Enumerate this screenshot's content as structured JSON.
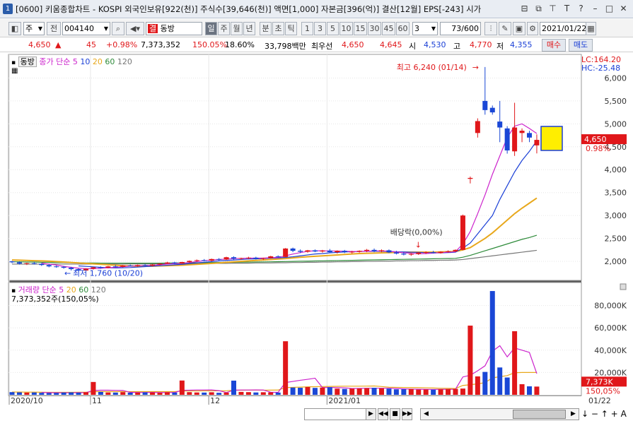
{
  "title": {
    "window_number": "1",
    "text": "[0600] 키움종합차트 - KOSPI 외국인보유[922(천)] 주식수[39,646(천)] 액면[1,000] 자본금[396(억)] 결산[12월] EPS[-243] 시가"
  },
  "toolbar": {
    "market": "주",
    "prev": "전",
    "code": "004140",
    "name_tag": "결",
    "name": "동방",
    "periods": [
      "일",
      "주",
      "월",
      "년",
      "분",
      "초",
      "틱"
    ],
    "active_period": "일",
    "intervals": [
      "1",
      "3",
      "5",
      "10",
      "15",
      "30",
      "45",
      "60"
    ],
    "custom": "3",
    "count": "73/600",
    "date": "2021/01/22"
  },
  "quote": {
    "price": "4,650",
    "arrow": "▲",
    "change": "45",
    "change_pct": "+0.98%",
    "volume": "7,373,352",
    "vol_pct": "150.05%",
    "turnover": "18.60%",
    "amount": "33,798백만",
    "best_label": "최우선",
    "ask": "4,650",
    "bid": "4,645",
    "open_label": "시",
    "open": "4,530",
    "high_label": "고",
    "high": "4,770",
    "low_label": "저",
    "low": "4,355",
    "buy": "매수",
    "sell": "매도"
  },
  "price_panel": {
    "name": "동방",
    "ma_label": "종가 단순",
    "ma_periods": [
      "5",
      "10",
      "20",
      "60",
      "120"
    ],
    "lc": "LC:164.20",
    "hc": "HC:-25.48",
    "y_ticks": [
      "6,000",
      "5,500",
      "5,000",
      "4,500",
      "4,000",
      "3,500",
      "3,000",
      "2,500",
      "2,000"
    ],
    "current_price": "4,650",
    "current_pct": "0.98%",
    "high_annotation": "최고 6,240 (01/14)",
    "low_annotation": "최저 1,760 (10/20)",
    "dividend_annotation": "배당락(0,00%)"
  },
  "volume_panel": {
    "label": "거래량",
    "ma_label": "단순",
    "ma_periods": [
      "5",
      "20",
      "60",
      "120"
    ],
    "value_text": "7,373,352주(150,05%)",
    "y_ticks": [
      "80,000K",
      "60,000K",
      "40,000K",
      "20,000K"
    ],
    "current_vol": "7,373K",
    "current_pct": "150,05%"
  },
  "x_axis": {
    "labels": [
      "2020/10",
      "11",
      "12",
      "2021/01"
    ],
    "right_label": "01/22"
  },
  "colors": {
    "up": "#e0171a",
    "down": "#1a47d6",
    "ma5": "#cc22cc",
    "ma10": "#1a3fd6",
    "ma20": "#e8a81c",
    "ma60": "#2e8b3a",
    "ma120": "#777777"
  },
  "chart_data": {
    "type": "candlestick",
    "candles": [
      [
        2000,
        2010,
        1960,
        1980
      ],
      [
        1980,
        2000,
        1930,
        1950
      ],
      [
        1950,
        1970,
        1920,
        1960
      ],
      [
        1960,
        1990,
        1930,
        1945
      ],
      [
        1945,
        1960,
        1900,
        1920
      ],
      [
        1920,
        1940,
        1870,
        1890
      ],
      [
        1890,
        1910,
        1860,
        1880
      ],
      [
        1880,
        1900,
        1840,
        1860
      ],
      [
        1860,
        1880,
        1800,
        1830
      ],
      [
        1830,
        1850,
        1760,
        1800
      ],
      [
        1800,
        1850,
        1790,
        1840
      ],
      [
        1840,
        1880,
        1820,
        1870
      ],
      [
        1870,
        1890,
        1840,
        1860
      ],
      [
        1860,
        1900,
        1850,
        1890
      ],
      [
        1890,
        1920,
        1870,
        1880
      ],
      [
        1880,
        1920,
        1870,
        1910
      ],
      [
        1910,
        1930,
        1890,
        1900
      ],
      [
        1900,
        1930,
        1880,
        1920
      ],
      [
        1920,
        1940,
        1890,
        1905
      ],
      [
        1905,
        1940,
        1890,
        1930
      ],
      [
        1930,
        1960,
        1920,
        1950
      ],
      [
        1950,
        1990,
        1940,
        1975
      ],
      [
        1975,
        1990,
        1940,
        1955
      ],
      [
        1955,
        1990,
        1950,
        1985
      ],
      [
        1985,
        2020,
        1970,
        2010
      ],
      [
        2010,
        2040,
        1990,
        2025
      ],
      [
        2025,
        2050,
        2000,
        2015
      ],
      [
        2015,
        2060,
        2000,
        2050
      ],
      [
        2050,
        2070,
        2020,
        2040
      ],
      [
        2040,
        2100,
        2030,
        2090
      ],
      [
        2090,
        2110,
        2040,
        2060
      ],
      [
        2060,
        2080,
        2030,
        2070
      ],
      [
        2070,
        2100,
        2050,
        2080
      ],
      [
        2080,
        2100,
        2040,
        2055
      ],
      [
        2055,
        2080,
        2030,
        2070
      ],
      [
        2070,
        2120,
        2060,
        2110
      ],
      [
        2110,
        2130,
        2080,
        2095
      ],
      [
        2095,
        2290,
        2090,
        2280
      ],
      [
        2280,
        2300,
        2200,
        2230
      ],
      [
        2230,
        2260,
        2180,
        2210
      ],
      [
        2210,
        2250,
        2190,
        2240
      ],
      [
        2240,
        2260,
        2200,
        2215
      ],
      [
        2215,
        2250,
        2190,
        2235
      ],
      [
        2235,
        2270,
        2190,
        2200
      ],
      [
        2200,
        2240,
        2170,
        2230
      ],
      [
        2230,
        2250,
        2180,
        2200
      ],
      [
        2200,
        2230,
        2170,
        2210
      ],
      [
        2210,
        2240,
        2190,
        2230
      ],
      [
        2230,
        2270,
        2200,
        2250
      ],
      [
        2250,
        2280,
        2200,
        2220
      ],
      [
        2220,
        2260,
        2200,
        2240
      ],
      [
        2240,
        2260,
        2180,
        2195
      ],
      [
        2195,
        2230,
        2150,
        2170
      ],
      [
        2170,
        2200,
        2130,
        2150
      ],
      [
        2150,
        2180,
        2120,
        2160
      ],
      [
        2160,
        2200,
        2140,
        2190
      ],
      [
        2190,
        2220,
        2160,
        2200
      ],
      [
        2200,
        2230,
        2170,
        2180
      ],
      [
        2180,
        2220,
        2170,
        2210
      ],
      [
        2210,
        2240,
        2190,
        2220
      ],
      [
        2220,
        2260,
        2200,
        2250
      ],
      [
        2250,
        3020,
        2240,
        3000
      ],
      [
        3800,
        3850,
        3700,
        3820
      ],
      [
        4800,
        5120,
        4700,
        5060
      ],
      [
        5500,
        6240,
        5200,
        5300
      ],
      [
        5350,
        5400,
        5200,
        5250
      ],
      [
        5050,
        5500,
        4600,
        4920
      ],
      [
        4900,
        4950,
        4350,
        4420
      ],
      [
        4400,
        5460,
        4300,
        4920
      ],
      [
        4800,
        4900,
        4600,
        4850
      ],
      [
        4800,
        4850,
        4600,
        4700
      ],
      [
        4530,
        4770,
        4355,
        4650
      ]
    ],
    "volume_k": [
      2400,
      2200,
      2000,
      2100,
      1800,
      1600,
      1700,
      2000,
      2200,
      1900,
      2300,
      11500,
      2600,
      2100,
      2000,
      2400,
      1900,
      2000,
      2200,
      2100,
      1800,
      2300,
      2000,
      12800,
      2400,
      2100,
      2000,
      2300,
      1800,
      2000,
      12700,
      2600,
      2400,
      2100,
      2300,
      2200,
      2000,
      48000,
      6500,
      6300,
      7000,
      6200,
      6500,
      6800,
      5500,
      5300,
      5600,
      5700,
      6000,
      6300,
      5800,
      5500,
      4900,
      5000,
      5200,
      4700,
      4800,
      4600,
      5000,
      5200,
      5300,
      5600,
      62000,
      16500,
      20500,
      93000,
      24500,
      15500,
      57000,
      9500,
      7600,
      7373
    ],
    "ma5": [
      null,
      null,
      null,
      null,
      1960,
      1940,
      1920,
      1890,
      1870,
      1850,
      1840,
      1840,
      1850,
      1860,
      1870,
      1885,
      1895,
      1905,
      1910,
      1915,
      1925,
      1940,
      1950,
      1960,
      1975,
      1995,
      2015,
      2030,
      2040,
      2050,
      2060,
      2065,
      2070,
      2070,
      2070,
      2080,
      2085,
      2120,
      2160,
      2190,
      2220,
      2230,
      2230,
      2225,
      2225,
      2220,
      2215,
      2215,
      2220,
      2225,
      2230,
      2220,
      2205,
      2190,
      2175,
      2165,
      2170,
      2180,
      2190,
      2200,
      2210,
      2380,
      2650,
      3040,
      3450,
      3900,
      4300,
      4700,
      4950,
      5000,
      4900,
      4790
    ],
    "ma10": [
      null,
      null,
      null,
      null,
      null,
      null,
      null,
      null,
      null,
      1900,
      1890,
      1880,
      1870,
      1860,
      1855,
      1860,
      1865,
      1875,
      1885,
      1895,
      1905,
      1915,
      1925,
      1935,
      1950,
      1965,
      1980,
      1995,
      2010,
      2020,
      2030,
      2040,
      2050,
      2055,
      2060,
      2070,
      2075,
      2085,
      2100,
      2120,
      2140,
      2160,
      2170,
      2185,
      2195,
      2205,
      2210,
      2215,
      2220,
      2220,
      2220,
      2215,
      2210,
      2205,
      2200,
      2195,
      2190,
      2185,
      2185,
      2190,
      2200,
      2290,
      2400,
      2600,
      2800,
      3000,
      3350,
      3650,
      3950,
      4200,
      4400,
      4630
    ],
    "ma20": [
      2030,
      2025,
      2020,
      2015,
      2010,
      2005,
      1995,
      1985,
      1975,
      1965,
      1955,
      1945,
      1935,
      1925,
      1915,
      1905,
      1900,
      1895,
      1895,
      1895,
      1900,
      1905,
      1910,
      1915,
      1925,
      1935,
      1945,
      1955,
      1965,
      1980,
      1990,
      2000,
      2010,
      2020,
      2030,
      2040,
      2050,
      2060,
      2075,
      2090,
      2100,
      2110,
      2120,
      2130,
      2140,
      2150,
      2160,
      2170,
      2175,
      2180,
      2185,
      2190,
      2195,
      2200,
      2200,
      2200,
      2200,
      2200,
      2205,
      2210,
      2215,
      2250,
      2300,
      2400,
      2500,
      2620,
      2760,
      2900,
      3040,
      3160,
      3270,
      3380
    ],
    "ma60": [
      1990,
      1990,
      1985,
      1985,
      1980,
      1980,
      1975,
      1975,
      1970,
      1970,
      1965,
      1965,
      1960,
      1960,
      1960,
      1960,
      1960,
      1960,
      1960,
      1960,
      1960,
      1962,
      1964,
      1966,
      1968,
      1970,
      1972,
      1974,
      1976,
      1978,
      1980,
      1982,
      1984,
      1986,
      1988,
      1990,
      1993,
      1996,
      1999,
      2002,
      2005,
      2008,
      2011,
      2014,
      2017,
      2020,
      2023,
      2026,
      2029,
      2032,
      2035,
      2038,
      2041,
      2044,
      2047,
      2050,
      2053,
      2056,
      2059,
      2062,
      2065,
      2090,
      2130,
      2180,
      2230,
      2280,
      2330,
      2380,
      2430,
      2480,
      2520,
      2570
    ],
    "ma120": [
      1940,
      1940,
      1940,
      1940,
      1940,
      1940,
      1940,
      1940,
      1940,
      1940,
      1940,
      1940,
      1940,
      1940,
      1940,
      1940,
      1945,
      1945,
      1945,
      1945,
      1945,
      1950,
      1950,
      1950,
      1950,
      1950,
      1955,
      1955,
      1955,
      1955,
      1960,
      1960,
      1960,
      1965,
      1965,
      1965,
      1970,
      1970,
      1975,
      1975,
      1980,
      1980,
      1985,
      1985,
      1990,
      1990,
      1995,
      1995,
      2000,
      2000,
      2005,
      2005,
      2010,
      2010,
      2015,
      2015,
      2020,
      2020,
      2025,
      2025,
      2030,
      2040,
      2060,
      2080,
      2100,
      2120,
      2140,
      2160,
      2180,
      2200,
      2220,
      2240
    ],
    "vol_ma5": [
      null,
      null,
      null,
      null,
      2100,
      1940,
      1840,
      1840,
      1860,
      1880,
      1940,
      3860,
      4100,
      4100,
      4000,
      3900,
      2200,
      2080,
      2100,
      2120,
      2000,
      2080,
      2080,
      4040,
      4100,
      4300,
      4300,
      4400,
      3700,
      2040,
      4100,
      4300,
      4300,
      4400,
      4300,
      2300,
      2200,
      11000,
      12000,
      13000,
      13900,
      14900,
      6500,
      6600,
      6400,
      6300,
      5600,
      5700,
      5900,
      5900,
      5900,
      5900,
      5600,
      5300,
      5100,
      5000,
      4900,
      4800,
      4900,
      4900,
      5000,
      16000,
      17500,
      21500,
      26000,
      39000,
      44000,
      34000,
      42000,
      40000,
      38000,
      19000
    ],
    "vol_ma20": [
      2500,
      2450,
      2400,
      2350,
      2300,
      2250,
      2200,
      2200,
      2250,
      2300,
      2300,
      2800,
      2850,
      2850,
      2850,
      2850,
      2850,
      2850,
      2850,
      2850,
      2850,
      2850,
      2900,
      3400,
      3450,
      3500,
      3550,
      3550,
      3550,
      3600,
      4100,
      4100,
      4150,
      4150,
      4150,
      4200,
      4250,
      6500,
      6700,
      6900,
      7100,
      7300,
      7400,
      7500,
      7600,
      7700,
      7700,
      7700,
      7800,
      7900,
      7400,
      6800,
      6700,
      6600,
      6500,
      6400,
      6300,
      6100,
      5900,
      5800,
      5600,
      8400,
      9000,
      9800,
      10900,
      15200,
      16200,
      17200,
      19800,
      20000,
      20000,
      20000
    ],
    "x_axis_labels": [
      "2020/10",
      "11",
      "12",
      "2021/01"
    ],
    "x_axis_label_index": [
      0,
      11,
      27,
      43
    ],
    "y_price_range": [
      1600,
      6500
    ],
    "y_volume_range": [
      0,
      100000
    ]
  }
}
